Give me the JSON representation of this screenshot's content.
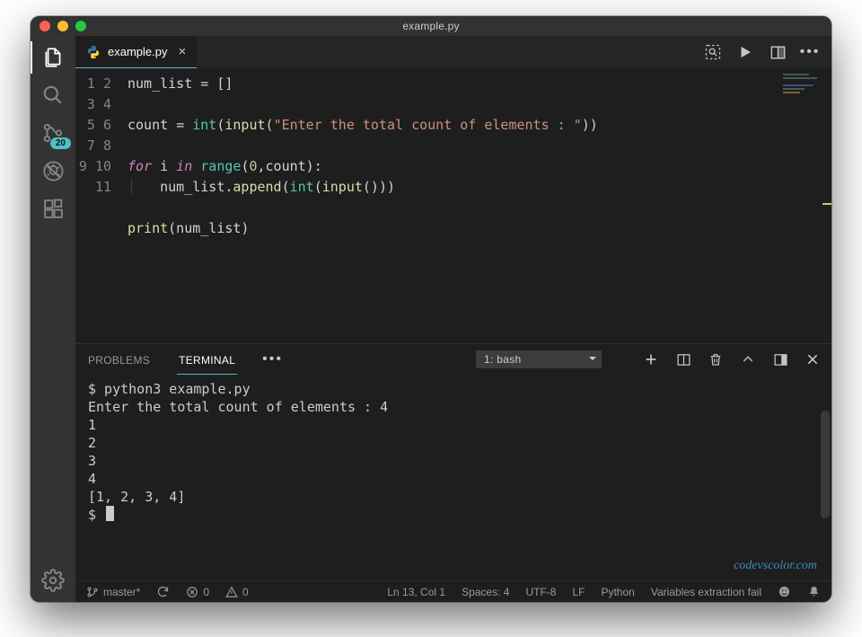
{
  "window": {
    "title": "example.py"
  },
  "tab": {
    "filename": "example.py"
  },
  "activity": {
    "scm_badge": "20"
  },
  "code": {
    "lines": [
      "num_list = []",
      "",
      "count = int(input(\"Enter the total count of elements : \"))",
      "",
      "for i in range(0,count):",
      "    num_list.append(int(input()))",
      "",
      "print(num_list)",
      "",
      "",
      ""
    ],
    "line_count": 11
  },
  "panel": {
    "tabs": {
      "problems": "PROBLEMS",
      "terminal": "TERMINAL"
    },
    "terminal_select": "1: bash",
    "output_lines": [
      "$ python3 example.py",
      "Enter the total count of elements : 4",
      "1",
      "2",
      "3",
      "4",
      "[1, 2, 3, 4]",
      "$ "
    ]
  },
  "statusbar": {
    "branch": "master*",
    "errors": "0",
    "warnings": "0",
    "position": "Ln 13, Col 1",
    "spaces": "Spaces: 4",
    "encoding": "UTF-8",
    "eol": "LF",
    "language": "Python",
    "message": "Variables extraction fail"
  },
  "watermark": "codevscolor.com"
}
